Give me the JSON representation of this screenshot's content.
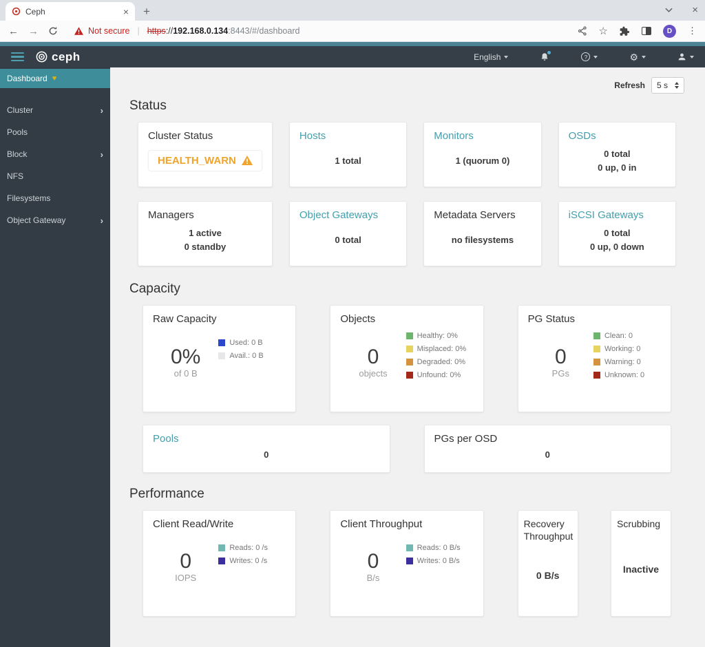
{
  "browser": {
    "tab": {
      "title": "Ceph"
    },
    "toolbar": {
      "not_secure_label": "Not secure",
      "url": {
        "scheme": "https",
        "sep": "://",
        "host": "192.168.0.134",
        "rest": ":8443/#/dashboard"
      },
      "avatar_initial": "D"
    }
  },
  "navbar": {
    "brand": "ceph",
    "language": "English"
  },
  "sidebar": {
    "items": [
      {
        "label": "Dashboard"
      },
      {
        "label": "Cluster"
      },
      {
        "label": "Pools"
      },
      {
        "label": "Block"
      },
      {
        "label": "NFS"
      },
      {
        "label": "Filesystems"
      },
      {
        "label": "Object Gateway"
      }
    ]
  },
  "refresh": {
    "label": "Refresh",
    "value": "5 s"
  },
  "icons": {
    "close": "×",
    "plus": "+",
    "back": "←",
    "forward": "→",
    "kebab": "⋮",
    "star": "☆",
    "chevron_right": "›",
    "health_badge": "♥",
    "gear": "⚙",
    "help": "?"
  },
  "colors": {
    "accent_teal": "#3d8e9a",
    "link_teal": "#41a0ad",
    "warn_orange": "#efa42d",
    "navbar_dark": "#363f48",
    "sidebar_dark": "#333c44"
  },
  "status": {
    "title": "Status",
    "cluster_status": {
      "title": "Cluster Status",
      "value": "HEALTH_WARN"
    },
    "cards": [
      {
        "title": "Hosts",
        "line1": "1 total",
        "line2": ""
      },
      {
        "title": "Monitors",
        "line1": "1 (quorum 0)",
        "line2": ""
      },
      {
        "title": "OSDs",
        "line1": "0 total",
        "line2": "0 up, 0 in"
      },
      {
        "title": "Managers",
        "line1": "1 active",
        "line2": "0 standby"
      },
      {
        "title": "Object Gateways",
        "line1": "0 total",
        "line2": ""
      },
      {
        "title": "Metadata Servers",
        "line1": "no filesystems",
        "line2": ""
      },
      {
        "title": "iSCSI Gateways",
        "line1": "0 total",
        "line2": "0 up, 0 down"
      }
    ]
  },
  "capacity": {
    "title": "Capacity",
    "raw": {
      "title": "Raw Capacity",
      "number": "0%",
      "sub": "of 0 B",
      "legend": [
        {
          "label": "Used: 0 B",
          "color": "#2b47cb"
        },
        {
          "label": "Avail.: 0 B",
          "color": "#e7e7e9"
        }
      ]
    },
    "objects": {
      "title": "Objects",
      "number": "0",
      "sub": "objects",
      "legend": [
        {
          "label": "Healthy: 0%",
          "color": "#6cb56a"
        },
        {
          "label": "Misplaced: 0%",
          "color": "#e8d35f"
        },
        {
          "label": "Degraded: 0%",
          "color": "#d6933d"
        },
        {
          "label": "Unfound: 0%",
          "color": "#a3281a"
        }
      ]
    },
    "pg_status": {
      "title": "PG Status",
      "number": "0",
      "sub": "PGs",
      "legend": [
        {
          "label": "Clean: 0",
          "color": "#6cb56a"
        },
        {
          "label": "Working: 0",
          "color": "#e8d35f"
        },
        {
          "label": "Warning: 0",
          "color": "#d6933d"
        },
        {
          "label": "Unknown: 0",
          "color": "#a3281a"
        }
      ]
    },
    "pools": {
      "title": "Pools",
      "value": "0"
    },
    "pgs_per_osd": {
      "title": "PGs per OSD",
      "value": "0"
    }
  },
  "performance": {
    "title": "Performance",
    "client_rw": {
      "title": "Client Read/Write",
      "number": "0",
      "sub": "IOPS",
      "legend": [
        {
          "label": "Reads: 0 /s",
          "color": "#71b8b2"
        },
        {
          "label": "Writes: 0 /s",
          "color": "#3a2f9d"
        }
      ]
    },
    "client_tp": {
      "title": "Client Throughput",
      "number": "0",
      "sub": "B/s",
      "legend": [
        {
          "label": "Reads: 0 B/s",
          "color": "#71b8b2"
        },
        {
          "label": "Writes: 0 B/s",
          "color": "#3a2f9d"
        }
      ]
    },
    "recovery": {
      "title": "Recovery Throughput",
      "value": "0 B/s"
    },
    "scrubbing": {
      "title": "Scrubbing",
      "value": "Inactive"
    }
  }
}
